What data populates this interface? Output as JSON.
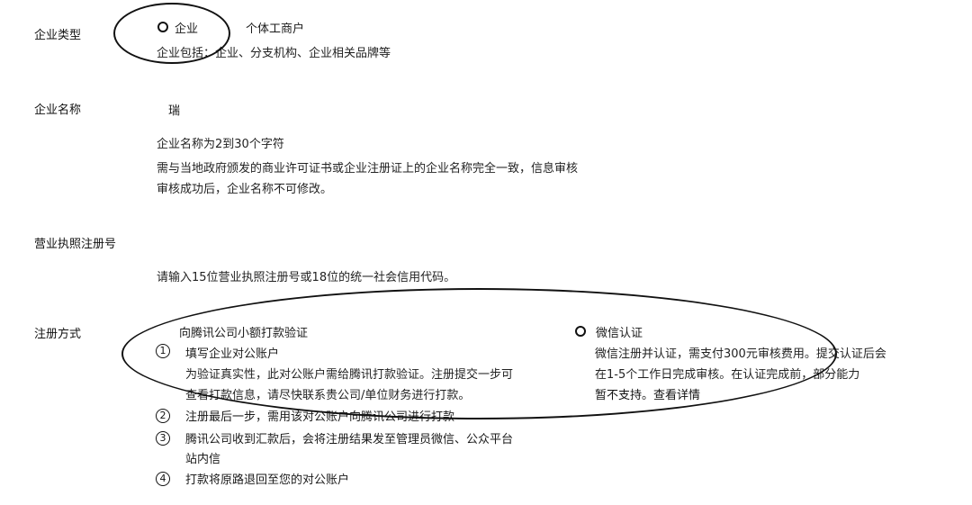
{
  "enterprise_type": {
    "label": "企业类型",
    "options": [
      {
        "label": "企业",
        "selected": true
      },
      {
        "label": "个体工商户",
        "selected": false
      }
    ],
    "description": "企业包括：企业、分支机构、企业相关品牌等"
  },
  "enterprise_name": {
    "label": "企业名称",
    "value": "瑞",
    "hint_1": "企业名称为2到30个字符",
    "hint_2": "需与当地政府颁发的商业许可证书或企业注册证上的企业名称完全一致，信息审核",
    "hint_3": "审核成功后，企业名称不可修改。"
  },
  "license_number": {
    "label": "营业执照注册号",
    "placeholder": "请输入15位营业执照注册号或18位的统一社会信用代码。"
  },
  "registration_method": {
    "label": "注册方式",
    "option_transfer": {
      "label": "向腾讯公司小额打款验证",
      "selected": false
    },
    "option_wechat": {
      "label": "微信认证",
      "selected": true,
      "desc_1": "微信注册并认证，需支付300元审核费用。提交认证后会",
      "desc_2": "在1-5个工作日完成审核。在认证完成前，部分能力",
      "desc_3": "暂不支持。",
      "link": "查看详情"
    },
    "steps": [
      {
        "num": "1",
        "title": "填写企业对公账户",
        "desc_1": "为验证真实性，此对公账户需给腾讯打款验证。注册提交一步可",
        "desc_2": "查看打款信息，请尽快联系贵公司/单位财务进行打款。"
      },
      {
        "num": "2",
        "title": "注册最后一步，需用该对公账户向腾讯公司进行打款"
      },
      {
        "num": "3",
        "title": "腾讯公司收到汇款后，会将注册结果发至管理员微信、公众平台",
        "title_2": "站内信"
      },
      {
        "num": "4",
        "title": "打款将原路退回至您的对公账户"
      }
    ]
  }
}
